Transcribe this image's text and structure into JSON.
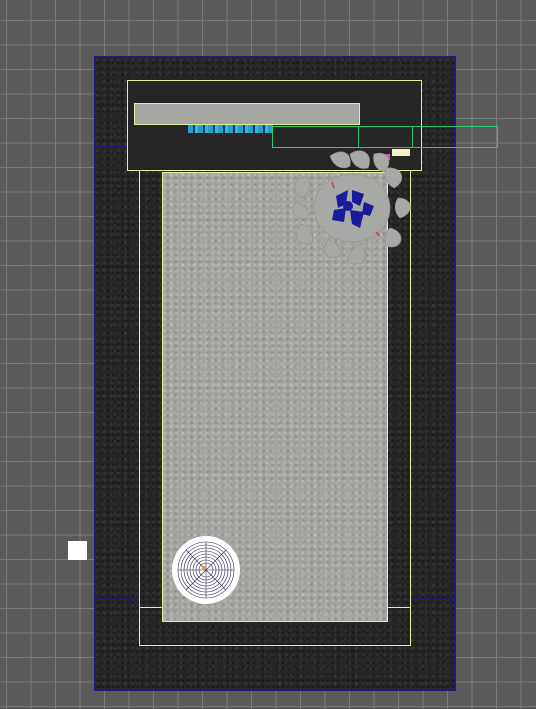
{
  "scene": {
    "description_type": "top-down-floor-plan-viewport",
    "colors": {
      "background": "#5a5a5a",
      "grid_line": "#7a7a7a",
      "slab": "#262626",
      "slab_border": "#1c1d7a",
      "outline_yellow": "#e6efa0",
      "outline_green": "#2ec76a",
      "bed_surface": "#a3a4a0",
      "plant_leaf": "#a7a9a7",
      "plant_accent": "#1a1a9a",
      "accent_pink": "#e04ad0",
      "marker_white": "#ffffff"
    },
    "objects": [
      {
        "name": "floor-slab",
        "icon": "rect"
      },
      {
        "name": "bed",
        "icon": "bed-icon"
      },
      {
        "name": "headboard",
        "icon": "headboard-icon"
      },
      {
        "name": "potted-plant",
        "icon": "plant-icon"
      },
      {
        "name": "floor-lamp",
        "icon": "lamp-icon"
      },
      {
        "name": "selection-handle",
        "icon": "square-marker-icon"
      }
    ]
  }
}
